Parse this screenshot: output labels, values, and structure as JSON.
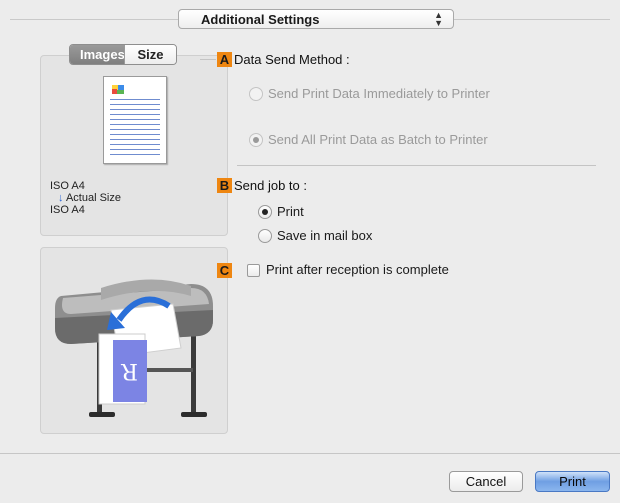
{
  "header": {
    "panel_select": "Additional Settings"
  },
  "preview": {
    "tabs": [
      "Images",
      "Size"
    ],
    "active_tab": "Images",
    "paper_from": "ISO A4",
    "scale_label": "Actual Size",
    "paper_to": "ISO A4"
  },
  "sections": {
    "a": {
      "badge": "A",
      "title": "Data Send Method :",
      "options": [
        {
          "label": "Send Print Data Immediately to Printer",
          "selected": false,
          "enabled": false
        },
        {
          "label": "Send All Print Data as Batch to Printer",
          "selected": true,
          "enabled": false
        }
      ]
    },
    "b": {
      "badge": "B",
      "title": "Send job to :",
      "options": [
        {
          "label": "Print",
          "selected": true,
          "enabled": true
        },
        {
          "label": "Save in mail box",
          "selected": false,
          "enabled": true
        }
      ]
    },
    "c": {
      "badge": "C",
      "checkbox_label": "Print after reception is complete",
      "checked": false
    }
  },
  "buttons": {
    "cancel": "Cancel",
    "print": "Print"
  },
  "colors": {
    "badge": "#ee8611",
    "default_button": "#6f9fe3",
    "preview_lines": "#6f8ccf"
  }
}
